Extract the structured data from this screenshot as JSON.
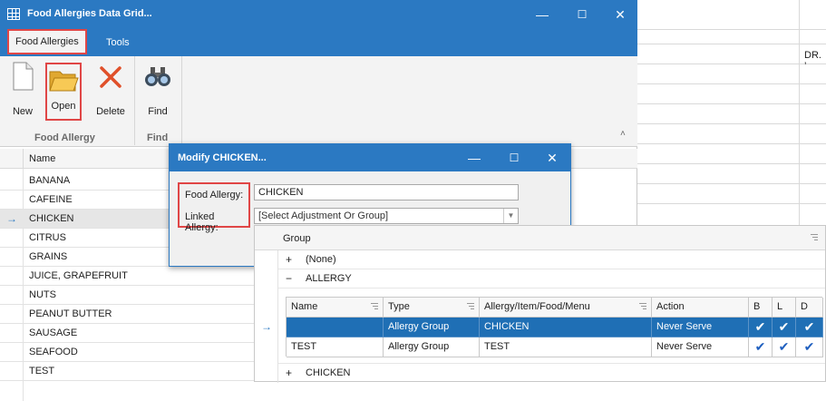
{
  "window": {
    "title": "Food Allergies Data Grid...",
    "buttons": {
      "minimize": "—",
      "maximize": "☐",
      "close": "✕"
    }
  },
  "ribbon": {
    "tabs": [
      "Food Allergies",
      "Tools"
    ],
    "buttons": {
      "new": "New",
      "open": "Open",
      "delete": "Delete",
      "find": "Find"
    },
    "groups": {
      "food_allergy": "Food Allergy",
      "find": "Find"
    }
  },
  "background": {
    "cell_text": "DR. ’"
  },
  "grid": {
    "column_header": "Name",
    "selected_indicator": "→",
    "rows": [
      "BANANA",
      "CAFEINE",
      "CHICKEN",
      "CITRUS",
      "GRAINS",
      "JUICE, GRAPEFRUIT",
      "NUTS",
      "PEANUT BUTTER",
      "SAUSAGE",
      "SEAFOOD",
      "TEST"
    ]
  },
  "dialog": {
    "title": "Modify CHICKEN...",
    "food_allergy_label": "Food Allergy:",
    "food_allergy_value": "CHICKEN",
    "linked_allergy_label": "Linked Allergy:",
    "linked_allergy_value": "[Select Adjustment Or Group]"
  },
  "group_panel": {
    "header": "Group",
    "groups": [
      {
        "toggle": "+",
        "label": "(None)"
      },
      {
        "toggle": "−",
        "label": "ALLERGY"
      },
      {
        "toggle": "+",
        "label": "CHICKEN"
      }
    ],
    "columns": [
      "Name",
      "Type",
      "Allergy/Item/Food/Menu",
      "Action",
      "B",
      "L",
      "D"
    ],
    "rows": [
      {
        "name": "",
        "type": "Allergy Group",
        "item": "CHICKEN",
        "action": "Never Serve",
        "b": "✔",
        "l": "✔",
        "d": "✔"
      },
      {
        "name": "TEST",
        "type": "Allergy Group",
        "item": "TEST",
        "action": "Never Serve",
        "b": "✔",
        "l": "✔",
        "d": "✔"
      }
    ]
  }
}
